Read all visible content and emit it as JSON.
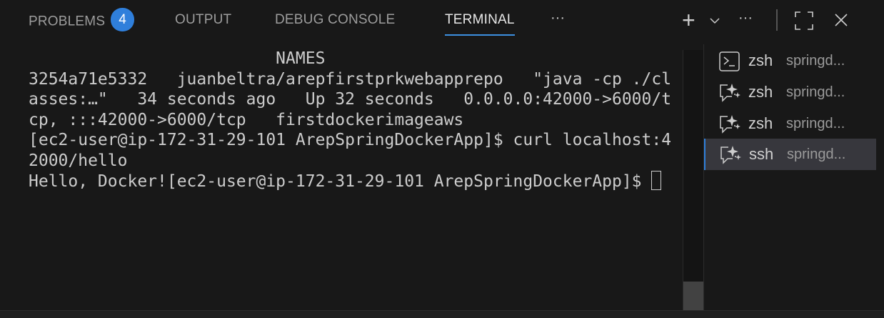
{
  "tabs": [
    {
      "label": "PROBLEMS",
      "badge": "4"
    },
    {
      "label": "OUTPUT"
    },
    {
      "label": "DEBUG CONSOLE"
    },
    {
      "label": "TERMINAL",
      "active": true
    }
  ],
  "toolbar": {
    "more_tabs": "···",
    "new_terminal": "+",
    "dropdown": "chevron-down-icon",
    "more": "···",
    "maximize": "maximize-icon",
    "close": "close-icon"
  },
  "terminal": {
    "lines": [
      "                         NAMES",
      "3254a71e5332   juanbeltra/arepfirstprkwebapprepo   \"java -cp ./cl",
      "asses:…\"   34 seconds ago   Up 32 seconds   0.0.0.0:42000->6000/t",
      "cp, :::42000->6000/tcp   firstdockerimageaws",
      "[ec2-user@ip-172-31-29-101 ArepSpringDockerApp]$ curl localhost:4",
      "2000/hello",
      "Hello, Docker![ec2-user@ip-172-31-29-101 ArepSpringDockerApp]$ "
    ]
  },
  "terminal_list": [
    {
      "name": "zsh",
      "desc": "springd...",
      "icon": "terminal-icon"
    },
    {
      "name": "zsh",
      "desc": "springd...",
      "icon": "sparkle-chat-icon"
    },
    {
      "name": "zsh",
      "desc": "springd...",
      "icon": "sparkle-chat-icon"
    },
    {
      "name": "ssh",
      "desc": "springd...",
      "icon": "sparkle-chat-icon",
      "selected": true
    }
  ],
  "colors": {
    "accent": "#2f7fdb",
    "background": "#181818",
    "selected": "#37373d"
  }
}
